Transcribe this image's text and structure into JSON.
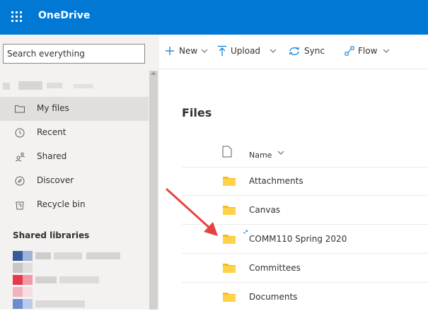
{
  "app": {
    "title": "OneDrive"
  },
  "colors": {
    "brand": "#0078d4",
    "nav_bg": "#f3f2f1",
    "selected_bg": "#e1dfdd",
    "folder": "#f4bb21",
    "annotation_arrow": "#e8423e"
  },
  "search": {
    "placeholder": "Search everything"
  },
  "sidebar": {
    "items": [
      {
        "label": "My files",
        "icon": "folder-outline-icon",
        "selected": true
      },
      {
        "label": "Recent",
        "icon": "clock-icon",
        "selected": false
      },
      {
        "label": "Shared",
        "icon": "people-icon",
        "selected": false
      },
      {
        "label": "Discover",
        "icon": "compass-icon",
        "selected": false
      },
      {
        "label": "Recycle bin",
        "icon": "recycle-bin-icon",
        "selected": false
      }
    ],
    "shared_libraries_title": "Shared libraries"
  },
  "commandbar": {
    "new_label": "New",
    "upload_label": "Upload",
    "sync_label": "Sync",
    "flow_label": "Flow"
  },
  "main": {
    "title": "Files",
    "column_name": "Name",
    "rows": [
      {
        "name": "Attachments",
        "icon": "folder-icon"
      },
      {
        "name": "Canvas",
        "icon": "folder-icon"
      },
      {
        "name": "COMM110 Spring 2020",
        "icon": "folder-icon",
        "new": true
      },
      {
        "name": "Committees",
        "icon": "folder-icon"
      },
      {
        "name": "Documents",
        "icon": "folder-icon"
      }
    ]
  }
}
